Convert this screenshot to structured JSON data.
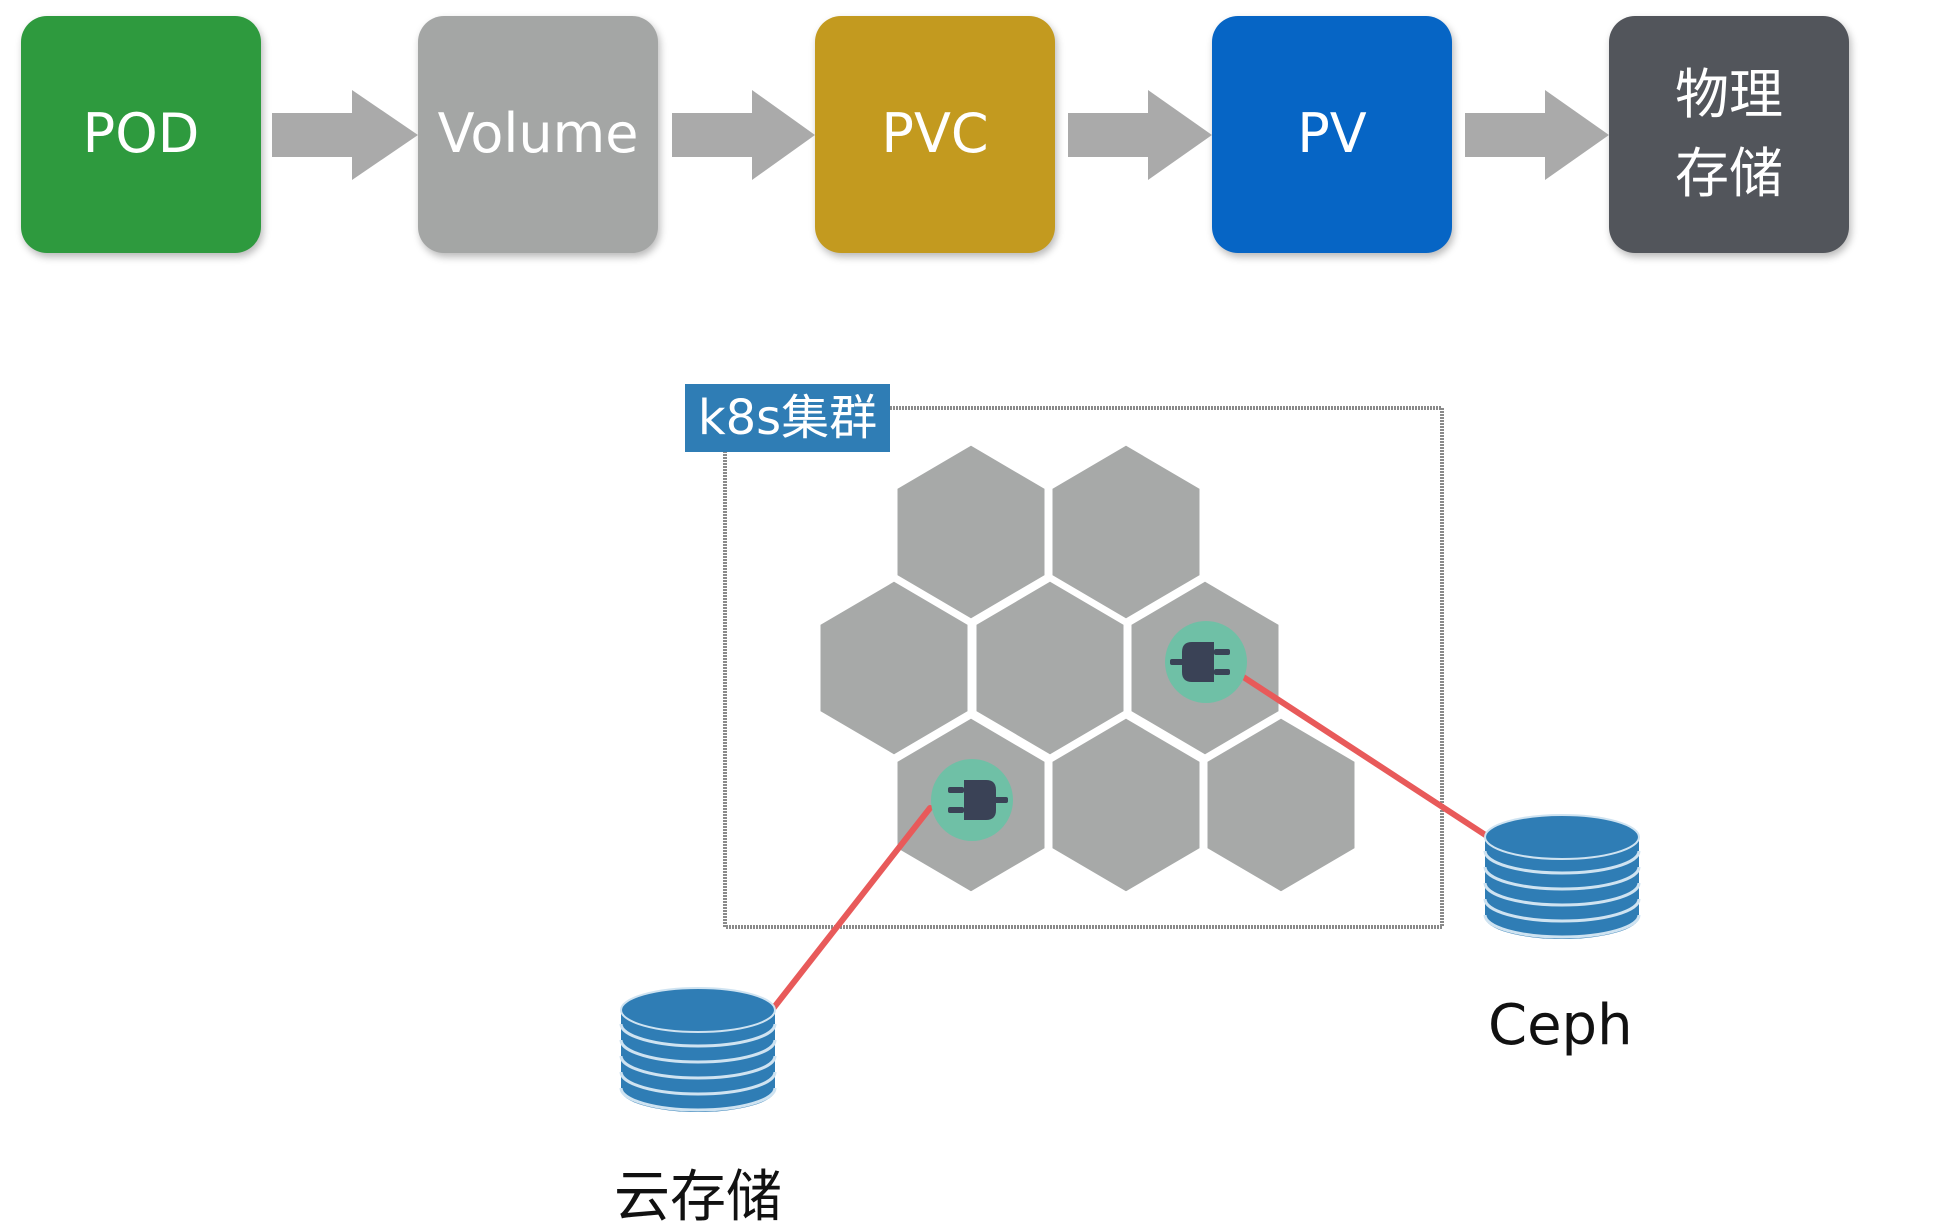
{
  "flow": {
    "pod_label": "POD",
    "volume_label": "Volume",
    "pvc_label": "PVC",
    "pv_label": "PV",
    "storage_label_line1": "物理",
    "storage_label_line2": "存储"
  },
  "cluster": {
    "label": "k8s集群"
  },
  "storage_targets": {
    "ceph_label": "Ceph",
    "cloud_label": "云存储"
  },
  "colors": {
    "pod": "#2e9a3e",
    "volume": "#a4a6a5",
    "pvc": "#c39a1f",
    "pv": "#0665c5",
    "storage": "#52555b",
    "arrow": "#aaaaaa",
    "hexagon": "#a7a9a8",
    "plug_circle": "#6fc0a6",
    "plug": "#3a4256",
    "connector_line": "#e85a5a",
    "database": "#2f7db5",
    "cluster_border": "#8a8a8a"
  },
  "icons": {
    "flow_arrow": "right-arrow-icon",
    "plug": "plug-icon",
    "database": "database-icon",
    "node": "hexagon-node"
  }
}
